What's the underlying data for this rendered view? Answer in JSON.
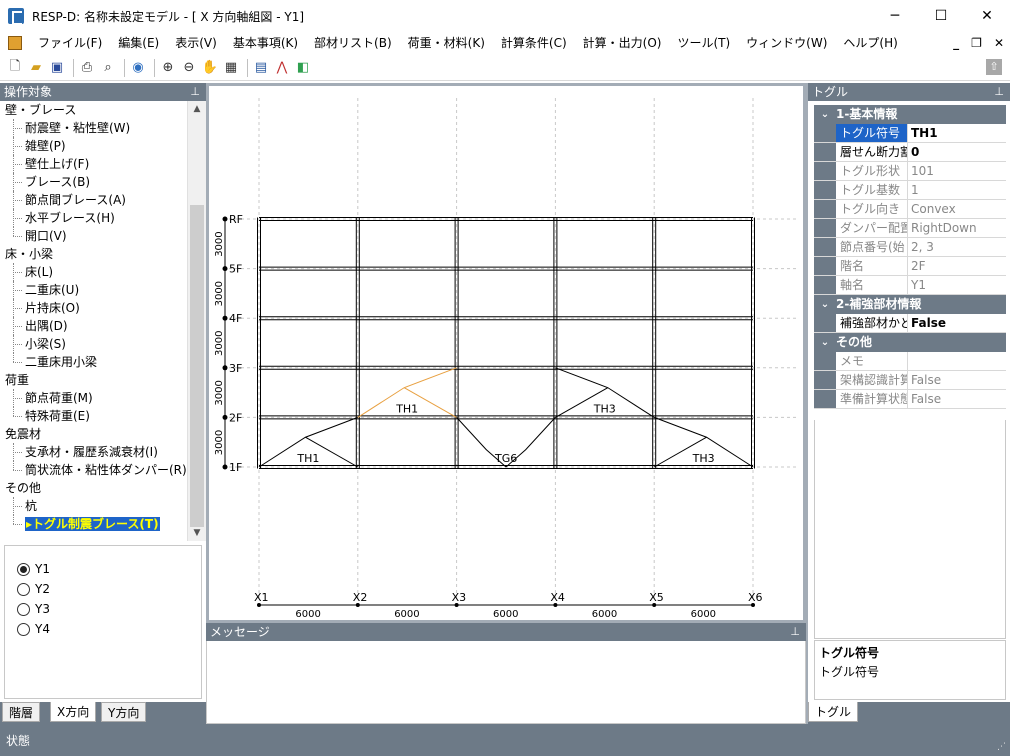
{
  "window": {
    "title": "RESP-D: 名称未設定モデル - [ X 方向軸組図 - Y1]",
    "minimize": "─",
    "maximize": "☐",
    "close": "✕"
  },
  "menu": [
    "ファイル(F)",
    "編集(E)",
    "表示(V)",
    "基本事項(K)",
    "部材リスト(B)",
    "荷重・材料(K)",
    "計算条件(C)",
    "計算・出力(O)",
    "ツール(T)",
    "ウィンドウ(W)",
    "ヘルプ(H)"
  ],
  "mdi_controls": {
    "minimize": "_",
    "restore": "❐",
    "close": "✕"
  },
  "left_panel": {
    "title": "操作対象",
    "tree": [
      {
        "label": "壁・ブレース",
        "level": 0
      },
      {
        "label": "耐震壁・粘性壁(W)",
        "level": 1
      },
      {
        "label": "雑壁(P)",
        "level": 1
      },
      {
        "label": "壁仕上げ(F)",
        "level": 1
      },
      {
        "label": "ブレース(B)",
        "level": 1
      },
      {
        "label": "節点間ブレース(A)",
        "level": 1
      },
      {
        "label": "水平ブレース(H)",
        "level": 1
      },
      {
        "label": "開口(V)",
        "level": 1,
        "last": true
      },
      {
        "label": "床・小梁",
        "level": 0
      },
      {
        "label": "床(L)",
        "level": 1
      },
      {
        "label": "二重床(U)",
        "level": 1
      },
      {
        "label": "片持床(O)",
        "level": 1
      },
      {
        "label": "出隅(D)",
        "level": 1
      },
      {
        "label": "小梁(S)",
        "level": 1
      },
      {
        "label": "二重床用小梁",
        "level": 1,
        "last": true
      },
      {
        "label": "荷重",
        "level": 0
      },
      {
        "label": "節点荷重(M)",
        "level": 1
      },
      {
        "label": "特殊荷重(E)",
        "level": 1,
        "last": true
      },
      {
        "label": "免震材",
        "level": 0
      },
      {
        "label": "支承材・履歴系減衰材(I)",
        "level": 1
      },
      {
        "label": "筒状流体・粘性体ダンパー(R)",
        "level": 1,
        "last": true
      },
      {
        "label": "その他",
        "level": 0
      },
      {
        "label": "杭",
        "level": 1
      },
      {
        "label": "▸トグル制震ブレース(T)",
        "level": 1,
        "last": true,
        "selected": true
      }
    ],
    "frames": [
      {
        "label": "Y1",
        "checked": true
      },
      {
        "label": "Y2",
        "checked": false
      },
      {
        "label": "Y3",
        "checked": false
      },
      {
        "label": "Y4",
        "checked": false
      }
    ],
    "tabs": [
      "階層",
      "X方向",
      "Y方向"
    ],
    "active_tab": "X方向"
  },
  "drawing": {
    "floors": [
      "1F",
      "2F",
      "3F",
      "4F",
      "5F",
      "RF"
    ],
    "story_heights": [
      "3000",
      "3000",
      "3000",
      "3000",
      "3000"
    ],
    "axes": [
      "X1",
      "X2",
      "X3",
      "X4",
      "X5",
      "X6"
    ],
    "spans": [
      "6000",
      "6000",
      "6000",
      "6000",
      "6000"
    ],
    "dampers": [
      {
        "label": "TH1",
        "bay": 0,
        "story": 0,
        "direction": "right",
        "color": "#000000"
      },
      {
        "label": "TH1",
        "bay": 1,
        "story": 1,
        "direction": "right",
        "color": "#e8a040"
      },
      {
        "label": "TG6",
        "bay": 2,
        "story": 0,
        "direction": "both",
        "color": "#000000"
      },
      {
        "label": "TH3",
        "bay": 3,
        "story": 1,
        "direction": "left",
        "color": "#000000"
      },
      {
        "label": "TH3",
        "bay": 4,
        "story": 0,
        "direction": "left",
        "color": "#000000"
      }
    ]
  },
  "message_panel": {
    "title": "メッセージ"
  },
  "right_panel": {
    "title": "トグル",
    "categories": [
      {
        "name": "1-基本情報",
        "rows": [
          {
            "key": "トグル符号",
            "value": "TH1",
            "editable": true,
            "selected": true
          },
          {
            "key": "層せん断力割",
            "value": "0",
            "editable": true
          },
          {
            "key": "トグル形状",
            "value": "101"
          },
          {
            "key": "トグル基数",
            "value": "1"
          },
          {
            "key": "トグル向き",
            "value": "Convex"
          },
          {
            "key": "ダンパー配置",
            "value": "RightDown"
          },
          {
            "key": "節点番号(始",
            "value": "2, 3"
          },
          {
            "key": "階名",
            "value": "2F"
          },
          {
            "key": "軸名",
            "value": "Y1"
          }
        ]
      },
      {
        "name": "2-補強部材情報",
        "rows": [
          {
            "key": "補強部材かど",
            "value": "False",
            "editable": true
          }
        ]
      },
      {
        "name": "その他",
        "rows": [
          {
            "key": "メモ",
            "value": ""
          },
          {
            "key": "架構認識計算",
            "value": "False"
          },
          {
            "key": "準備計算状態",
            "value": "False"
          }
        ]
      }
    ],
    "help_title": "トグル符号",
    "help_desc": "トグル符号",
    "tab": "トグル"
  },
  "status": {
    "text": "状態"
  }
}
